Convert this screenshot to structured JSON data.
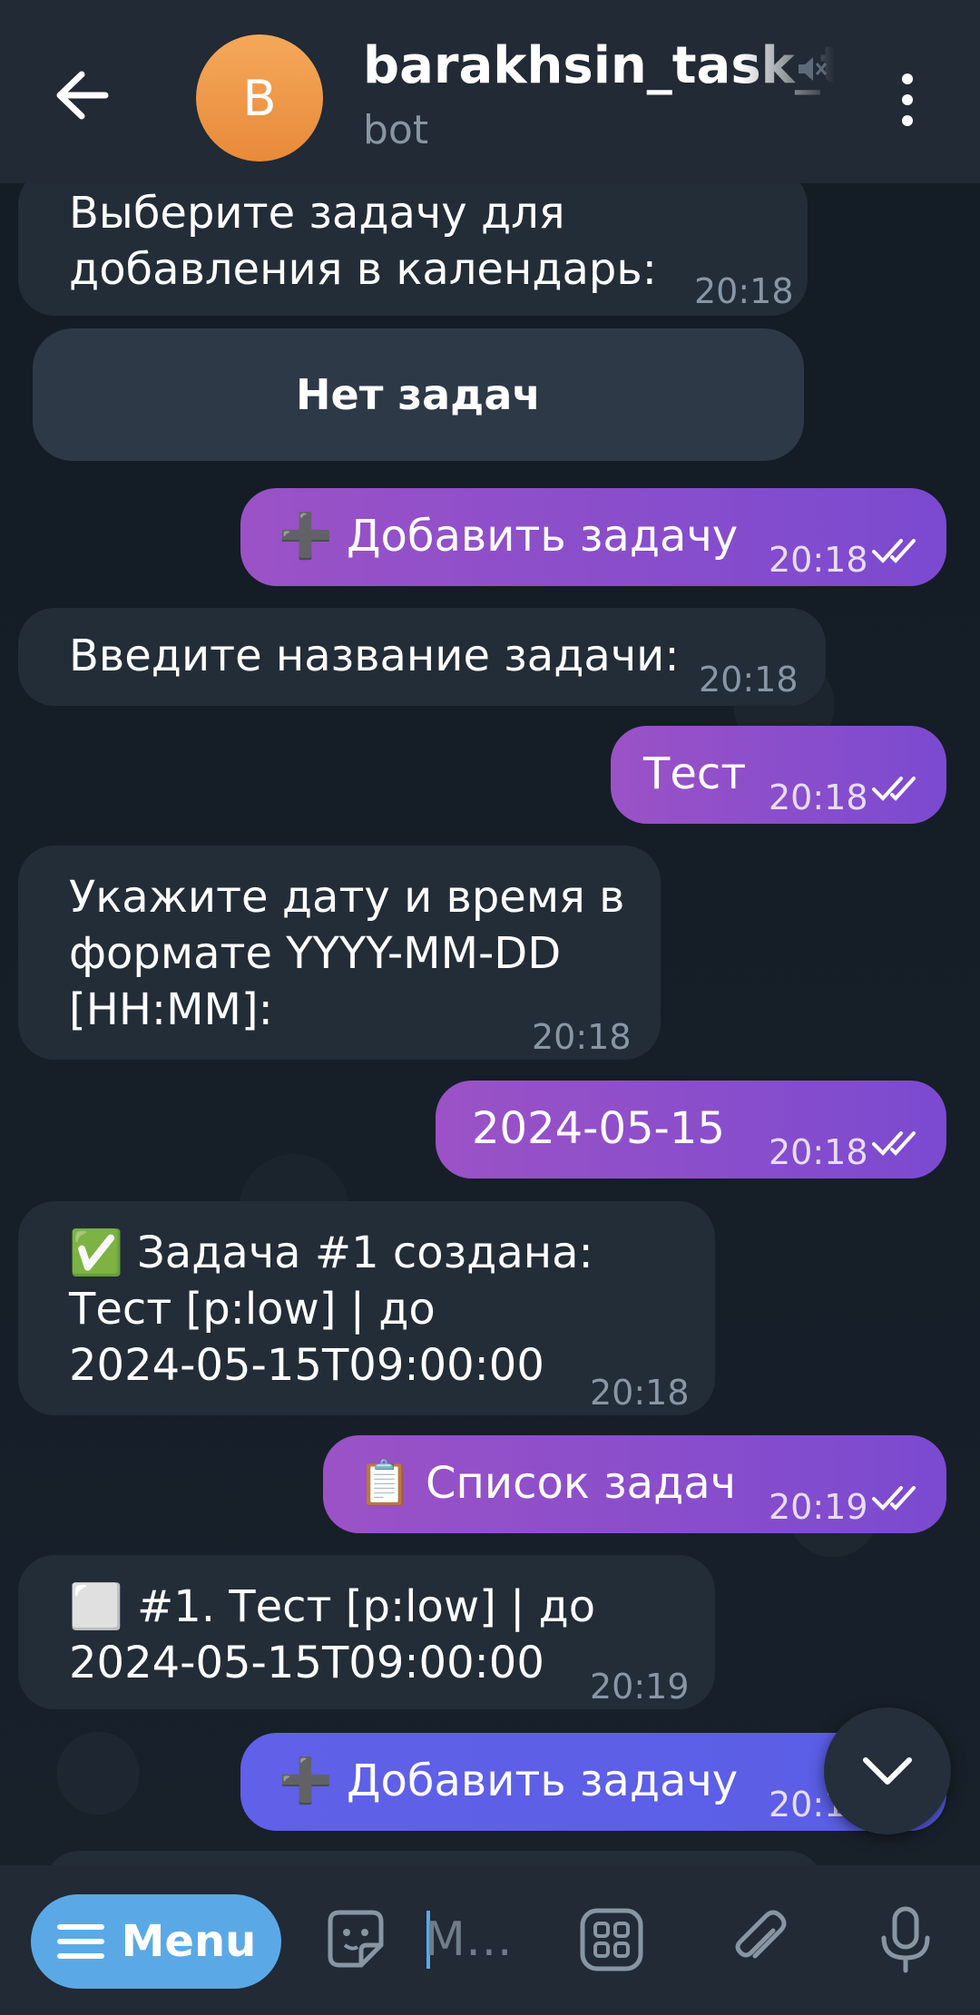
{
  "header": {
    "title": "barakhsin_task_t",
    "subtitle": "bot",
    "avatar_letter": "B"
  },
  "messages": [
    {
      "dir": "in",
      "text": "Выберите задачу для\nдобавления в календарь:",
      "time": "20:18"
    },
    {
      "dir": "out",
      "text": "➕ Добавить задачу",
      "time": "20:18"
    },
    {
      "dir": "in",
      "text": "Введите название задачи:",
      "time": "20:18"
    },
    {
      "dir": "out",
      "text": "Тест",
      "time": "20:18"
    },
    {
      "dir": "in",
      "text": "Укажите дату и время в\nформате YYYY-MM-DD\n[HH:MM]:",
      "time": "20:18"
    },
    {
      "dir": "out",
      "text": "2024-05-15",
      "time": "20:18"
    },
    {
      "dir": "in",
      "text": "✅ Задача #1 создана:\nТест [p:low] | до\n2024-05-15T09:00:00",
      "time": "20:18"
    },
    {
      "dir": "out",
      "text": "📋 Список задач",
      "time": "20:19"
    },
    {
      "dir": "in",
      "text": "⬜ #1. Тест [p:low] | до\n2024-05-15T09:00:00",
      "time": "20:19"
    },
    {
      "dir": "out",
      "text": "➕ Добавить задачу",
      "time": "20:1"
    }
  ],
  "inline_keyboard": {
    "button_label": "Нет задач"
  },
  "bottom_bar": {
    "menu_label": "Menu",
    "input_placeholder": "M…"
  },
  "colors": {
    "background": "#141c25",
    "header": "#212a35",
    "incoming_bubble": "#222d38",
    "outgoing_bubble": "#8a4ecb",
    "menu_button": "#5aa9e6"
  }
}
